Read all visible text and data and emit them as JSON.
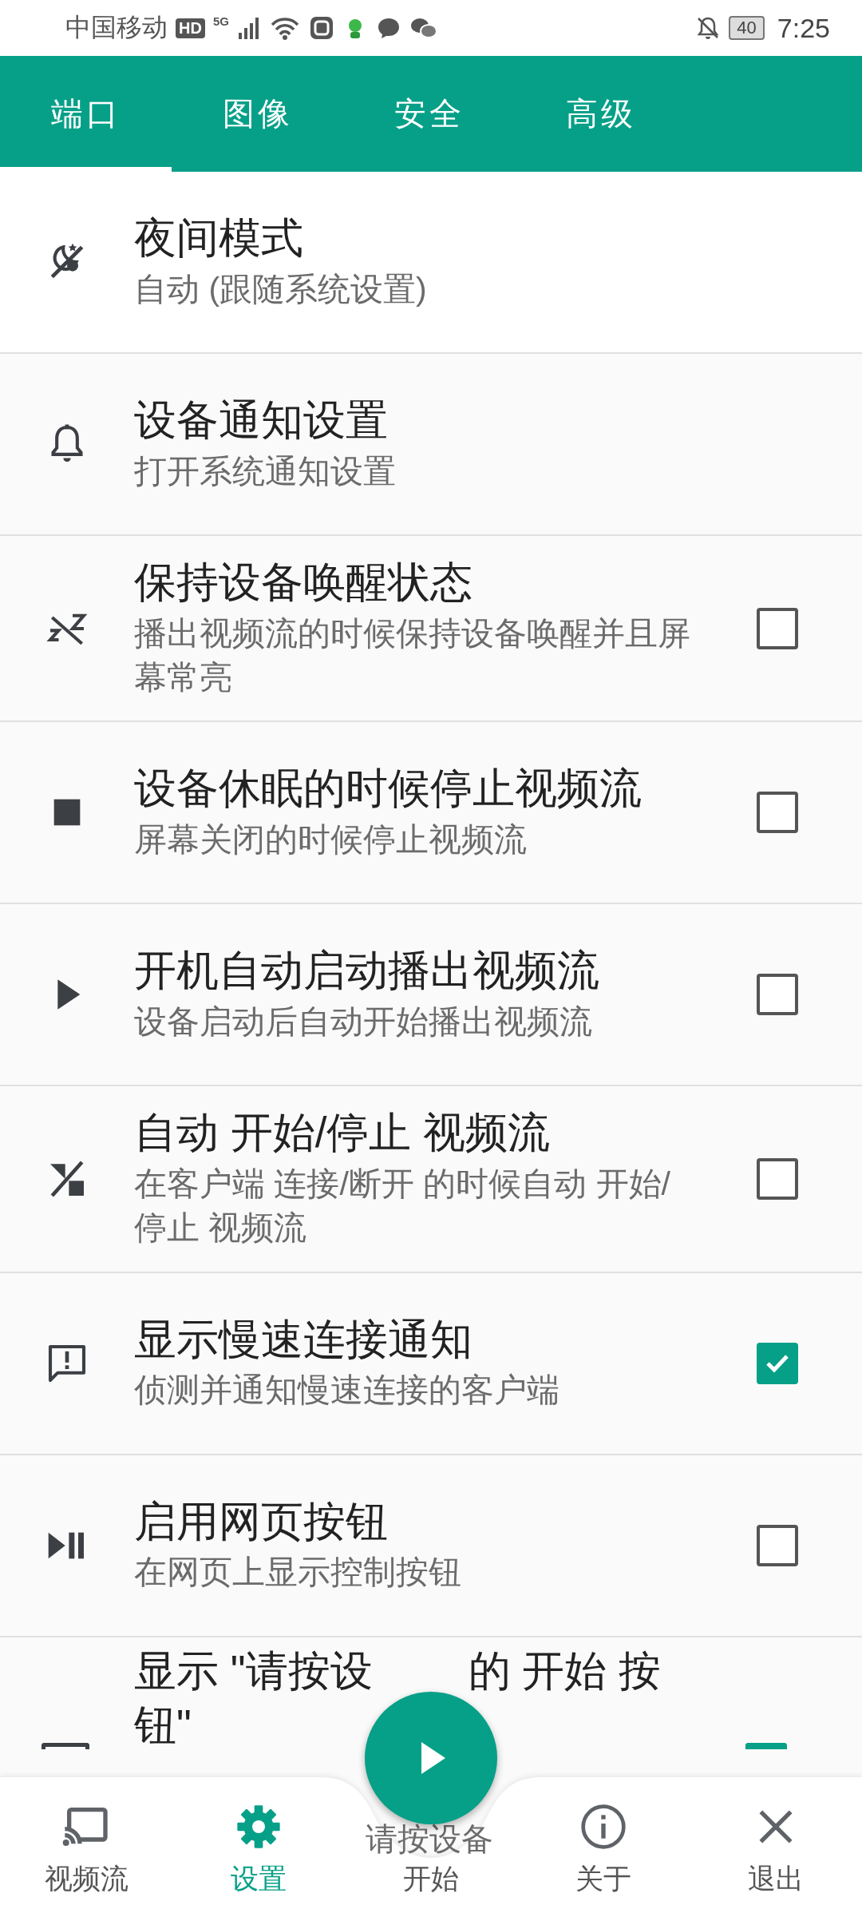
{
  "status_bar": {
    "carrier": "中国移动",
    "hd": "HD",
    "network": "5G",
    "battery": "40",
    "time": "7:25"
  },
  "tabs": [
    {
      "label": "端口",
      "selected": true
    },
    {
      "label": "图像",
      "selected": false
    },
    {
      "label": "安全",
      "selected": false
    },
    {
      "label": "高级",
      "selected": false
    }
  ],
  "settings": [
    {
      "kind": "plain",
      "title": "夜间模式",
      "subtitle": "自动 (跟随系统设置)"
    },
    {
      "kind": "plain",
      "title": "设备通知设置",
      "subtitle": "打开系统通知设置"
    },
    {
      "kind": "checkbox",
      "checked": false,
      "title": "保持设备唤醒状态",
      "subtitle": "播出视频流的时候保持设备唤醒并且屏幕常亮"
    },
    {
      "kind": "checkbox",
      "checked": false,
      "title": "设备休眠的时候停止视频流",
      "subtitle": "屏幕关闭的时候停止视频流"
    },
    {
      "kind": "checkbox",
      "checked": false,
      "title": "开机自动启动播出视频流",
      "subtitle": "设备启动后自动开始播出视频流"
    },
    {
      "kind": "checkbox",
      "checked": false,
      "title": "自动 开始/停止 视频流",
      "subtitle": "在客户端 连接/断开 的时候自动 开始/停止 视频流"
    },
    {
      "kind": "checkbox",
      "checked": true,
      "title": "显示慢速连接通知",
      "subtitle": "侦测并通知慢速连接的客户端"
    },
    {
      "kind": "checkbox",
      "checked": false,
      "title": "启用网页按钮",
      "subtitle": "在网页上显示控制按钮"
    },
    {
      "kind": "partial",
      "checked": true,
      "title": "显示 \"请按设",
      "title_rest": "的 开始 按",
      "title_line2": "钮\"",
      "subtitle": "请按设备"
    }
  ],
  "nav": [
    {
      "label": "视频流",
      "selected": false
    },
    {
      "label": "设置",
      "selected": true
    },
    {
      "label": "开始",
      "selected": false
    },
    {
      "label": "关于",
      "selected": false
    },
    {
      "label": "退出",
      "selected": false
    }
  ]
}
